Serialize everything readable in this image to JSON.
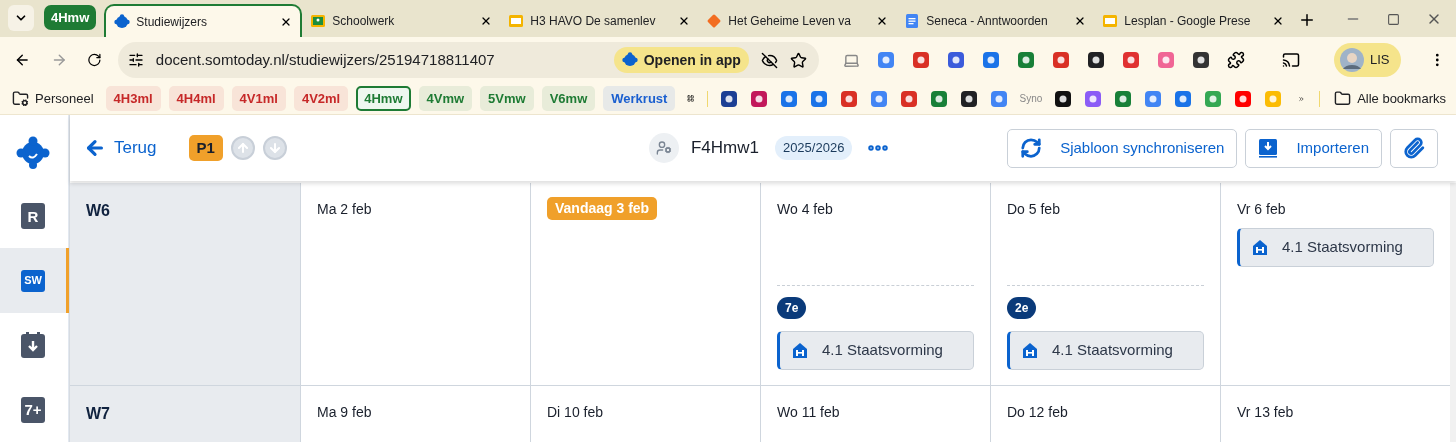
{
  "browser": {
    "tab_group": {
      "label": "4Hmw",
      "color": "#1e7b34"
    },
    "tabs": [
      {
        "title": "Studiewijzers",
        "kind": "somtoday",
        "selected": true
      },
      {
        "title": "Schoolwerk",
        "kind": "classroom",
        "selected": false
      },
      {
        "title": "H3 HAVO De samenlev",
        "kind": "slides",
        "selected": false
      },
      {
        "title": "Het Geheime Leven va",
        "kind": "start",
        "selected": false
      },
      {
        "title": "Seneca - Anntwoorden",
        "kind": "docs",
        "selected": false
      },
      {
        "title": "Lesplan - Google Prese",
        "kind": "slides",
        "selected": false
      }
    ],
    "url": "docent.somtoday.nl/studiewijzers/25194718811407",
    "open_in_app": "Openen in app",
    "profile": "LIS",
    "bookmarks": {
      "folder": "Personeel",
      "chips": [
        {
          "label": "4H3ml",
          "color": "#c62828",
          "selected": false
        },
        {
          "label": "4H4ml",
          "color": "#c62828",
          "selected": false
        },
        {
          "label": "4V1ml",
          "color": "#c62828",
          "selected": false
        },
        {
          "label": "4V2ml",
          "color": "#c62828",
          "selected": false
        },
        {
          "label": "4Hmw",
          "color": "#1e7b34",
          "selected": true
        },
        {
          "label": "4Vmw",
          "color": "#1e7b34",
          "selected": false
        },
        {
          "label": "5Vmw",
          "color": "#1e7b34",
          "selected": false
        },
        {
          "label": "V6mw",
          "color": "#1e7b34",
          "selected": false
        },
        {
          "label": "Werkrust",
          "color": "#1a5fd0",
          "selected": false
        }
      ],
      "syno": "Syno",
      "all": "Alle bookmarks"
    }
  },
  "app": {
    "sidebar": [
      {
        "kind": "logo",
        "selected": false
      },
      {
        "kind": "calendar",
        "glyph": "R",
        "selected": false
      },
      {
        "kind": "badge",
        "glyph": "SW",
        "selected": true
      },
      {
        "kind": "download",
        "selected": false
      },
      {
        "kind": "grade",
        "glyph": "7+",
        "selected": false
      }
    ],
    "header": {
      "back": "Terug",
      "period": "P1",
      "up_disabled": true,
      "down_disabled": true,
      "group": "F4Hmw1",
      "year": "2025/2026",
      "actions": [
        {
          "kind": "sync",
          "label": "Sjabloon synchroniseren"
        },
        {
          "kind": "import",
          "label": "Importeren"
        },
        {
          "kind": "attach"
        }
      ]
    },
    "weeks": [
      {
        "label": "W6",
        "days": [
          {
            "label": "Ma 2 feb",
            "today": false
          },
          {
            "label": "Vandaag 3 feb",
            "today": true
          },
          {
            "label": "Wo 4 feb",
            "today": false,
            "lessons": [
              {
                "hour": "7e",
                "items": [
                  "4.1 Staatsvorming"
                ]
              }
            ]
          },
          {
            "label": "Do 5 feb",
            "today": false,
            "lessons": [
              {
                "hour": "2e",
                "items": [
                  "4.1 Staatsvorming"
                ]
              }
            ]
          },
          {
            "label": "Vr 6 feb",
            "today": false,
            "items": [
              "4.1 Staatsvorming"
            ]
          }
        ]
      },
      {
        "label": "W7",
        "days": [
          {
            "label": "Ma 9 feb",
            "today": false
          },
          {
            "label": "Di 10 feb",
            "today": false
          },
          {
            "label": "Wo 11 feb",
            "today": false
          },
          {
            "label": "Do 12 feb",
            "today": false
          },
          {
            "label": "Vr 13 feb",
            "today": false
          }
        ]
      }
    ]
  }
}
